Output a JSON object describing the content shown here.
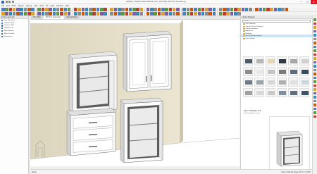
{
  "window": {
    "title": "Untitled - Chief Architect Premier X12 - [3D View: 3D Floor Overview 1]",
    "minimize": "─",
    "maximize": "☐",
    "close": "✕"
  },
  "menu": [
    "File",
    "Edit",
    "Build",
    "Terrain",
    "Library",
    "CAD",
    "Tools",
    "3D",
    "View",
    "Window",
    "Help"
  ],
  "toolbar_colors": [
    "#4a7fc1",
    "#5a9a3c",
    "#c0392b",
    "#e0a020",
    "#7d5ba6",
    "#2e8bc0",
    "#8a8a8a",
    "#d35400"
  ],
  "view_tabs": [
    {
      "label": "Floor Plan",
      "active": false
    },
    {
      "label": "3D Floor Overview 1",
      "active": true
    },
    {
      "label": "Cabinet Detail",
      "active": false
    }
  ],
  "left_panel": {
    "header": "Active Layer Set",
    "rows": [
      {
        "label": "Floor Plan View",
        "checked": true
      },
      {
        "label": "Cabinets, Base",
        "checked": true
      },
      {
        "label": "Cabinets, Wall",
        "checked": true
      },
      {
        "label": "Cabinets, Full",
        "checked": true
      },
      {
        "label": "Walls, Normal",
        "checked": true
      },
      {
        "label": "Walls, Invisible",
        "checked": false
      },
      {
        "label": "Dimensions",
        "checked": true
      }
    ]
  },
  "library": {
    "header": "Library Browser",
    "search_placeholder": "Search",
    "tree": [
      {
        "label": "Core Catalogs",
        "selected": false
      },
      {
        "label": "Cabinet Doors & Drawers",
        "selected": false
      },
      {
        "label": "Cabinet Hardware",
        "selected": false
      },
      {
        "label": "Appliances",
        "selected": false
      },
      {
        "label": "Moldings",
        "selected": false
      },
      {
        "label": "Shelving & Accessories",
        "selected": true
      },
      {
        "label": "User Catalog",
        "selected": false
      }
    ],
    "thumb_colors": [
      "#4d5b66",
      "#b6b6b6",
      "#e6d5b2",
      "#2f3a44",
      "#a8a8a8",
      "#d0d0d0",
      "#8c8c8c",
      "#e8e8e8",
      "#c4c4c4",
      "#7a7a7a",
      "#5c6e7c",
      "#3b4a58",
      "#6b7a86",
      "#9aa4ad",
      "#d8d8d8",
      "#b0b0b0",
      "#e0e0e0",
      "#ccd6de",
      "#a0a0a0",
      "#d8d8d8",
      "#c8c8c8",
      "#7c8f9e",
      "#5d6e7e",
      "#3e5366"
    ],
    "detail_title": "Open Shelf Base Unit",
    "detail_label": "Shelving & Accessories"
  },
  "status": {
    "left": "Ready",
    "right": "Layer: Cabinets, Base   |   Floor 1   |   100%"
  }
}
